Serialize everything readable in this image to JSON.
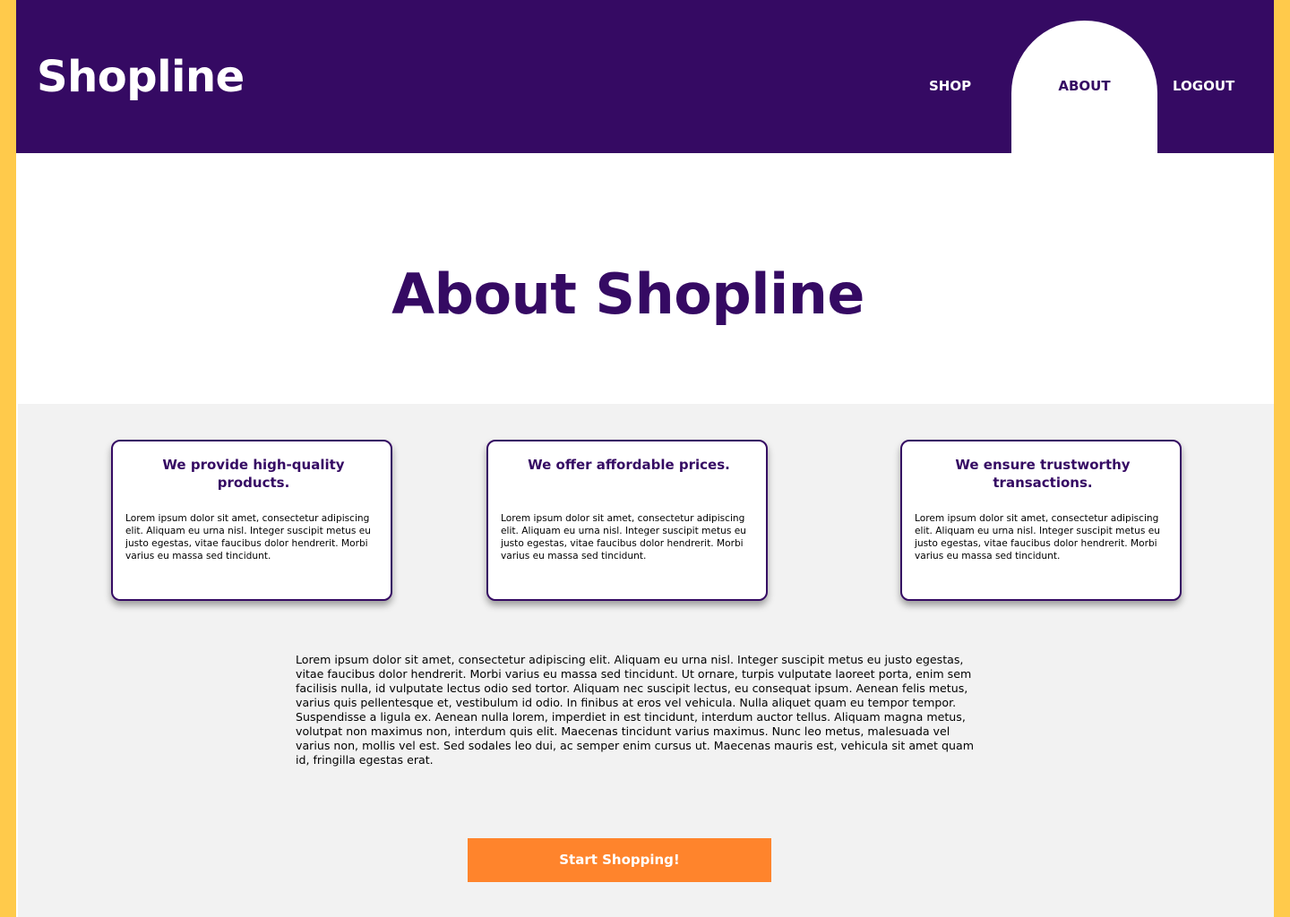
{
  "colors": {
    "frame": "#FFCA4B",
    "brand_purple": "#350A63",
    "content_bg": "#F2F2F2",
    "cta_orange": "#FF842C",
    "white": "#FFFFFF"
  },
  "header": {
    "logo": "Shopline",
    "nav": {
      "shop": "SHOP",
      "about": "ABOUT",
      "logout": "LOGOUT"
    },
    "active_nav": "ABOUT"
  },
  "hero": {
    "title": "About Shopline"
  },
  "cards": [
    {
      "title": "We provide high-quality products.",
      "body": "Lorem ipsum dolor sit amet, consectetur adipiscing elit. Aliquam eu urna nisl. Integer suscipit metus eu justo egestas, vitae faucibus dolor hendrerit. Morbi varius eu massa sed tincidunt."
    },
    {
      "title": "We offer affordable prices.",
      "body": "Lorem ipsum dolor sit amet, consectetur adipiscing elit. Aliquam eu urna nisl. Integer suscipit metus eu justo egestas, vitae faucibus dolor hendrerit. Morbi varius eu massa sed tincidunt."
    },
    {
      "title": "We ensure trustworthy transactions.",
      "body": "Lorem ipsum dolor sit amet, consectetur adipiscing elit. Aliquam eu urna nisl. Integer suscipit metus eu justo egestas, vitae faucibus dolor hendrerit. Morbi varius eu massa sed tincidunt."
    }
  ],
  "paragraph": "Lorem ipsum dolor sit amet, consectetur adipiscing elit. Aliquam eu urna nisl. Integer suscipit metus eu justo egestas, vitae faucibus dolor hendrerit. Morbi varius eu massa sed tincidunt. Ut ornare, turpis vulputate laoreet porta, enim sem facilisis nulla, id vulputate lectus odio sed tortor. Aliquam nec suscipit lectus, eu consequat ipsum. Aenean felis metus, varius quis pellentesque et, vestibulum id odio. In finibus at eros vel vehicula. Nulla aliquet quam eu tempor tempor. Suspendisse a ligula ex. Aenean nulla lorem, imperdiet in est tincidunt, interdum auctor tellus. Aliquam magna metus, volutpat non maximus non, interdum quis elit. Maecenas tincidunt varius maximus. Nunc leo metus, malesuada vel varius non, mollis vel est. Sed sodales leo dui, ac semper enim cursus ut. Maecenas mauris est, vehicula sit amet quam id, fringilla egestas erat.",
  "cta": {
    "label": "Start Shopping!"
  }
}
